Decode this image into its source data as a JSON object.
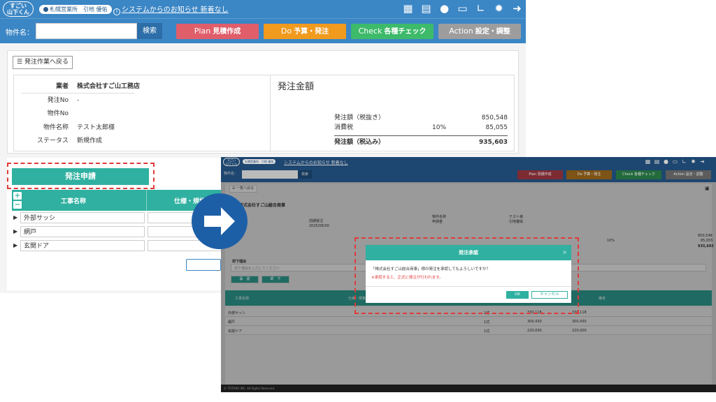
{
  "main": {
    "header": {
      "logo_text": "すごい\n山下くん",
      "office_badge": "札幌営業所　引地 優佑",
      "notice_text": "システムからのお知らせ 新着なし",
      "icons": [
        "building-icon",
        "calendar-icon",
        "chat-icon",
        "folder-icon",
        "chart-icon",
        "gear-icon",
        "logout-icon"
      ]
    },
    "search": {
      "label": "物件名：",
      "value": "",
      "button": "検索"
    },
    "phases": [
      {
        "en": "Plan",
        "jp": "見積作成",
        "color": "#e05e6a"
      },
      {
        "en": "Do",
        "jp": "予算・発注",
        "color": "#f09a1e"
      },
      {
        "en": "Check",
        "jp": "各種チェック",
        "color": "#3dba6a"
      },
      {
        "en": "Action",
        "jp": "設定・調整",
        "color": "#9d9d9d"
      }
    ],
    "back_button": "発注作業へ戻る",
    "info": {
      "vendor_label": "業者",
      "vendor_value": "株式会社すご山工務店",
      "order_no_label": "発注No",
      "order_no_value": "-",
      "property_no_label": "物件No",
      "property_no_value": "",
      "property_name_label": "物件名称",
      "property_name_value": "テスト太郎様",
      "status_label": "ステータス",
      "status_value": "新規作成"
    },
    "amount": {
      "title": "発注金額",
      "pretax_label": "発注額（税抜き）",
      "pretax_value": "850,548",
      "tax_label": "消費税",
      "tax_rate": "10%",
      "tax_value": "85,055",
      "total_label": "発注額（税込み）",
      "total_value": "935,603"
    },
    "request_button": "発注申請",
    "table": {
      "col_name": "工事名称",
      "col_spec": "仕様・規格",
      "rows": [
        "外部サッシ",
        "網戸",
        "玄関ドア"
      ]
    }
  },
  "overlay": {
    "header": {
      "badge": "札幌営業所　引地 優佑",
      "notice": "システムからのお知らせ 新着なし"
    },
    "search_label": "物件名：",
    "search_button": "検索",
    "phases": [
      {
        "en": "Plan",
        "jp": "見積作成",
        "color": "#7c2b33"
      },
      {
        "en": "Do",
        "jp": "予算・発注",
        "color": "#7d5316"
      },
      {
        "en": "Check",
        "jp": "各種チェック",
        "color": "#236a3d"
      },
      {
        "en": "Action",
        "jp": "設定・調整",
        "color": "#5c5c5c"
      }
    ],
    "back_button": "一覧へ戻る",
    "company": "株式会社すご山総合商事",
    "order_date_label": "発注日",
    "order_date_value": "2025/06/30",
    "order_no": "前期受注",
    "property_name_label": "物件名称",
    "property_name_value": "テスト様",
    "applicant_label": "申請者",
    "applicant_value": "引地優佑",
    "amount_pretax": "850,548",
    "tax_rate": "10%",
    "amount_tax": "85,055",
    "amount_total": "935,603",
    "remarks_label": "却下理由",
    "remarks_placeholder": "却下理由を入力してください",
    "approve_button": "承　認",
    "reject_button": "却　下",
    "table_col_name": "工事名称",
    "table_col_spec": "仕様・規格",
    "table_col_note": "備考",
    "rows": [
      {
        "name": "外部サッシ",
        "unit": "1式",
        "price": "330,118",
        "amount": "330,118"
      },
      {
        "name": "網戸",
        "unit": "1式",
        "price": "300,430",
        "amount": "300,430"
      },
      {
        "name": "玄関ドア",
        "unit": "1式",
        "price": "220,000",
        "amount": "220,000"
      }
    ],
    "footer": "© TOTORO INC. All Rights Reserved."
  },
  "modal": {
    "title": "発注承認",
    "question": "「株式会社すご山総合商事」様の発注を承認してもよろしいですか？",
    "warning": "※承認すると、正式に発注が行われます。",
    "ok": "OK",
    "cancel": "キャンセル"
  }
}
